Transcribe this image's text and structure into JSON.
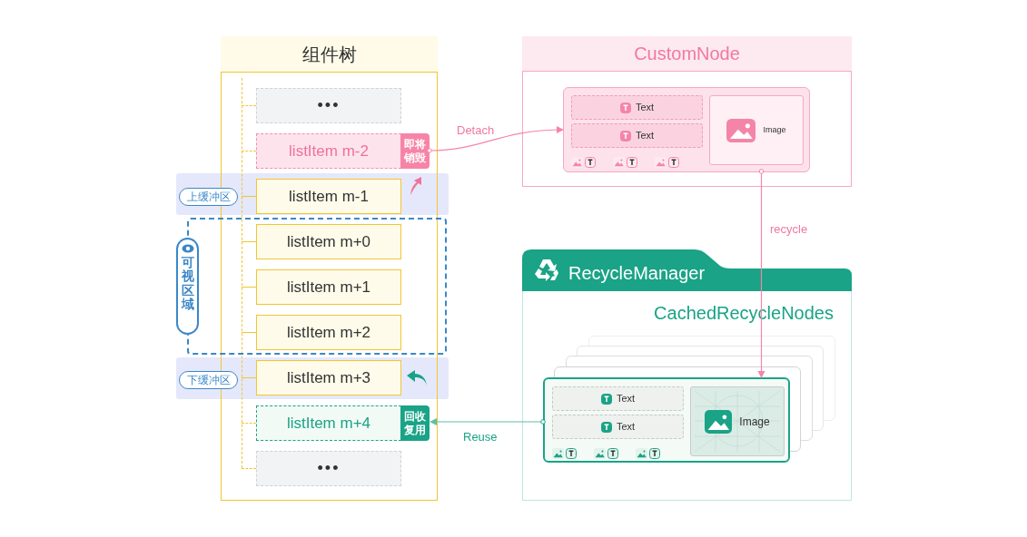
{
  "component_tree": {
    "title": "组件树",
    "items": [
      {
        "kind": "ellipsis",
        "label": "•••"
      },
      {
        "kind": "detaching",
        "label": "listItem m-2",
        "tag": "即将销毁"
      },
      {
        "kind": "normal",
        "label": "listItem m-1"
      },
      {
        "kind": "normal",
        "label": "listItem m+0"
      },
      {
        "kind": "normal",
        "label": "listItem m+1"
      },
      {
        "kind": "normal",
        "label": "listItem m+2"
      },
      {
        "kind": "normal",
        "label": "listItem m+3"
      },
      {
        "kind": "reused",
        "label": "listItem m+4",
        "tag": "回收复用"
      },
      {
        "kind": "ellipsis",
        "label": "•••"
      }
    ]
  },
  "zones": {
    "upper_buffer": "上缓冲区",
    "visible_area": "可视区域",
    "lower_buffer": "下缓冲区"
  },
  "custom_node": {
    "title": "CustomNode",
    "texts": [
      "Text",
      "Text"
    ],
    "image": "Image"
  },
  "arrows": {
    "detach": "Detach",
    "recycle": "recycle",
    "reuse": "Reuse"
  },
  "recycle_manager": {
    "title": "RecycleManager",
    "subtitle": "CachedRecycleNodes",
    "texts": [
      "Text",
      "Text"
    ],
    "image": "Image"
  }
}
